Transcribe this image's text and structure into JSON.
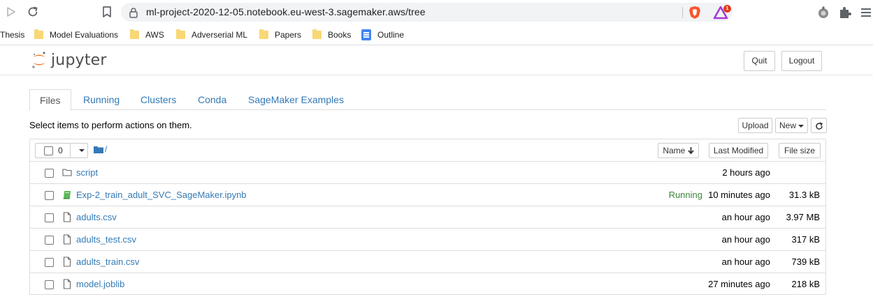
{
  "browser": {
    "url": "ml-project-2020-12-05.notebook.eu-west-3.sagemaker.aws/tree",
    "rewards_badge": "1",
    "bookmarks": [
      {
        "label": "Thesis",
        "icon": "none"
      },
      {
        "label": "Model Evaluations",
        "icon": "folder-icon"
      },
      {
        "label": "AWS",
        "icon": "folder-icon"
      },
      {
        "label": "Adverserial ML",
        "icon": "folder-icon"
      },
      {
        "label": "Papers",
        "icon": "folder-icon"
      },
      {
        "label": "Books",
        "icon": "folder-icon"
      },
      {
        "label": "Outline",
        "icon": "google-docs-icon"
      }
    ]
  },
  "header": {
    "logo_text": "jupyter",
    "quit_label": "Quit",
    "logout_label": "Logout"
  },
  "tabs": [
    {
      "label": "Files",
      "active": true
    },
    {
      "label": "Running",
      "active": false
    },
    {
      "label": "Clusters",
      "active": false
    },
    {
      "label": "Conda",
      "active": false
    },
    {
      "label": "SageMaker Examples",
      "active": false
    }
  ],
  "toolbar": {
    "instructions": "Select items to perform actions on them.",
    "upload_label": "Upload",
    "new_label": "New"
  },
  "list": {
    "selected_count": "0",
    "path": "/",
    "sort_name_label": "Name",
    "sort_modified_label": "Last Modified",
    "sort_size_label": "File size",
    "items": [
      {
        "name": "script",
        "type": "folder",
        "status": "",
        "modified": "2 hours ago",
        "size": ""
      },
      {
        "name": "Exp-2_train_adult_SVC_SageMaker.ipynb",
        "type": "notebook",
        "status": "Running",
        "modified": "10 minutes ago",
        "size": "31.3 kB"
      },
      {
        "name": "adults.csv",
        "type": "file",
        "status": "",
        "modified": "an hour ago",
        "size": "3.97 MB"
      },
      {
        "name": "adults_test.csv",
        "type": "file",
        "status": "",
        "modified": "an hour ago",
        "size": "317 kB"
      },
      {
        "name": "adults_train.csv",
        "type": "file",
        "status": "",
        "modified": "an hour ago",
        "size": "739 kB"
      },
      {
        "name": "model.joblib",
        "type": "file",
        "status": "",
        "modified": "27 minutes ago",
        "size": "218 kB"
      }
    ]
  },
  "colors": {
    "link": "#337ab7",
    "running": "#3c8a3c",
    "notebook_icon": "#5cb85c",
    "jupyter_orange": "#f37726"
  }
}
